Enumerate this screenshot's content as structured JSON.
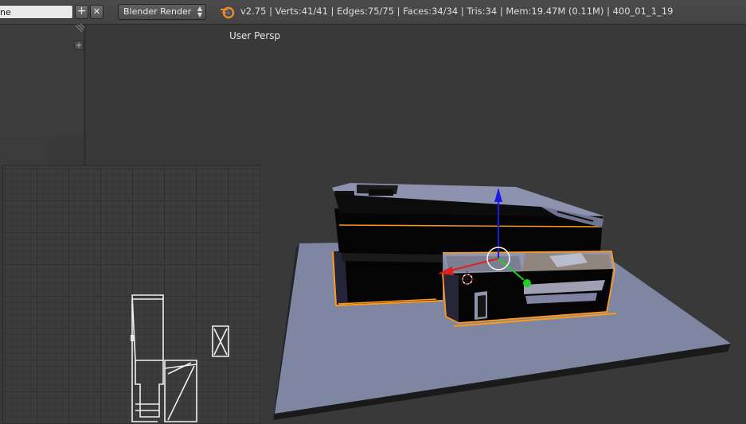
{
  "header": {
    "scene_name": "ne",
    "add_scene_symbol": "+",
    "remove_scene_symbol": "✕",
    "render_engine": "Blender Render",
    "engine_dropdown_arrows": "▲▼",
    "stats": "v2.75 | Verts:41/41 | Edges:75/75 | Faces:34/34 | Tris:34 | Mem:19.47M (0.11M) | 400_01_1_19"
  },
  "left_panel": {
    "plus_symbol": "+"
  },
  "viewport": {
    "label": "User Persp"
  },
  "icons": {
    "logo": "blender-logo-icon",
    "transform_manipulator": "transform-manipulator-icon",
    "cursor": "3d-cursor-icon"
  },
  "colors": {
    "header_bg": "#474747",
    "viewport_bg": "#393939",
    "ground_plane": "#7e849f",
    "selection_orange": "#ff9a18",
    "axis_x": "#e02020",
    "axis_y": "#20d020",
    "axis_z": "#1a1ae6"
  }
}
